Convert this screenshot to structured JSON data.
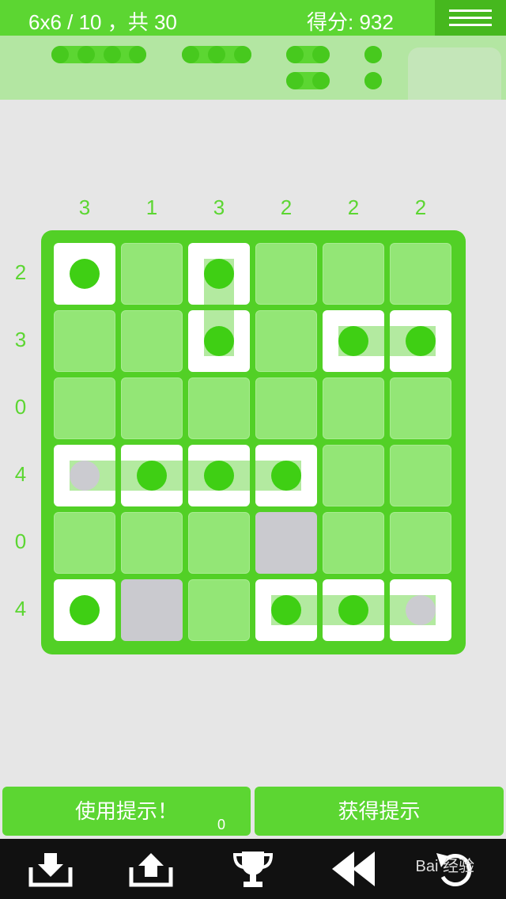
{
  "header": {
    "level": "6x6 / 10 ，共 30",
    "score": "得分: 932"
  },
  "fleet_sizes": [
    4,
    3,
    2,
    2,
    1,
    1
  ],
  "column_clues": [
    "3",
    "1",
    "3",
    "2",
    "2",
    "2"
  ],
  "row_clues": [
    "2",
    "3",
    "0",
    "4",
    "0",
    "4"
  ],
  "board": [
    [
      "ship-single",
      "water",
      "ship-top",
      "water",
      "water",
      "water"
    ],
    [
      "water",
      "water",
      "ship-bottom",
      "water",
      "ship-left",
      "ship-right"
    ],
    [
      "water",
      "water",
      "water",
      "water",
      "water",
      "water"
    ],
    [
      "ship-left-grey",
      "ship-mid",
      "ship-mid",
      "ship-right",
      "water",
      "water"
    ],
    [
      "water",
      "water",
      "water",
      "unknown",
      "water",
      "water"
    ],
    [
      "ship-single",
      "unknown",
      "water",
      "ship-left",
      "ship-mid",
      "ship-right-grey"
    ]
  ],
  "buttons": {
    "use_hint": "使用提示！",
    "hint_count": "0",
    "get_hint": "获得提示"
  },
  "toolbar": [
    "download-icon",
    "upload-icon",
    "trophy-icon",
    "rewind-icon",
    "undo-icon"
  ],
  "watermark": "Bai 经验",
  "colors": {
    "accent": "#5cd632",
    "board": "#52d026",
    "water": "#93e676",
    "ship_dot": "#3fcf14"
  }
}
